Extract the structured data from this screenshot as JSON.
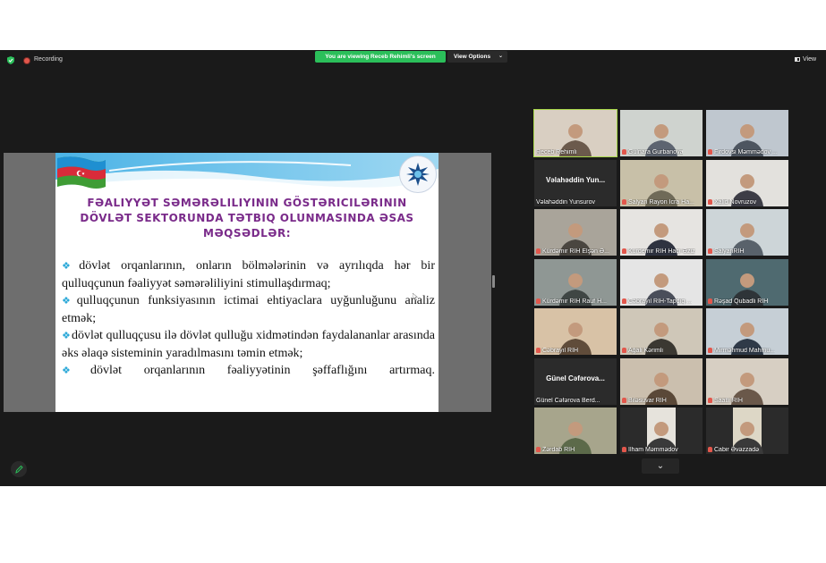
{
  "topbar": {
    "recording_label": "Recording",
    "banner_text": "You are viewing Receb Rehimli's screen",
    "view_options_label": "View Options",
    "view_label": "View"
  },
  "slide": {
    "title_lines": [
      "FƏALIYYƏT SƏMƏRƏLILIYININ GÖSTƏRICILƏRININ",
      "DÖVLƏT SEKTORUNDA TƏTBIQ OLUNMASINDA ƏSAS",
      "MƏQSƏDLƏR:"
    ],
    "bullets": [
      "dövlət orqanlarının, onların bölmələrinin və ayrılıqda hər bir qulluqçunun fəaliyyət səmərəliliyini stimullaşdırmaq;",
      "qulluqçunun funksiyasının ictimai ehtiyaclara uyğunluğunu analiz etmək;",
      "dövlət qulluqçusu ilə dövlət qulluğu xidmətindən faydalananlar arasında əks əlaqə sisteminin yaradılmasını təmin etmək;",
      "dövlət orqanlarının fəaliyyətinin şəffaflığını artırmaq."
    ]
  },
  "participants": [
    {
      "label": "Receb Rehimli",
      "muted": false,
      "active": true,
      "card": ""
    },
    {
      "label": "Gulnara Gurbanova",
      "muted": true,
      "active": false,
      "card": ""
    },
    {
      "label": "Firdovsi Məmmədov ...",
      "muted": true,
      "active": false,
      "card": ""
    },
    {
      "label": "Vəlahəddin Yunsurov",
      "muted": false,
      "active": false,
      "card": "Vəlahəddin Yun..."
    },
    {
      "label": "Salyan Rayon İcra Ha...",
      "muted": true,
      "active": false,
      "card": ""
    },
    {
      "label": "Xalid Novruzov",
      "muted": true,
      "active": false,
      "card": ""
    },
    {
      "label": "Kürdəmir RİH Elşən Ə...",
      "muted": true,
      "active": false,
      "card": ""
    },
    {
      "label": "Kurdemir RİH Hacı Əziz",
      "muted": true,
      "active": false,
      "card": ""
    },
    {
      "label": "SalyanRİH",
      "muted": true,
      "active": false,
      "card": ""
    },
    {
      "label": "Kürdəmir RİH Rauf H...",
      "muted": true,
      "active": false,
      "card": ""
    },
    {
      "label": "Cəbrayıl RİH-Tapdıq ...",
      "muted": true,
      "active": false,
      "card": ""
    },
    {
      "label": "Rəşad Qubadli RİH",
      "muted": true,
      "active": false,
      "card": ""
    },
    {
      "label": "Cəbrayıl RİH",
      "muted": true,
      "active": false,
      "card": ""
    },
    {
      "label": "Ağali Kərimli",
      "muted": true,
      "active": false,
      "card": ""
    },
    {
      "label": "Mirməhmud Mahmu...",
      "muted": true,
      "active": false,
      "card": ""
    },
    {
      "label": "Günel Cəfərova Berd...",
      "muted": false,
      "active": false,
      "card": "Günel Cəfərova..."
    },
    {
      "label": "Biləsuvar RİH",
      "muted": true,
      "active": false,
      "card": ""
    },
    {
      "label": "Saatlı RİH",
      "muted": true,
      "active": false,
      "card": ""
    },
    {
      "label": "Zərdab RİH",
      "muted": true,
      "active": false,
      "card": ""
    },
    {
      "label": "İlham Məmmədov",
      "muted": true,
      "active": false,
      "card": ""
    },
    {
      "label": "Cabir Əvəzzadə",
      "muted": true,
      "active": false,
      "card": ""
    }
  ],
  "icons": {
    "shield": "shield-icon",
    "recording": "recording-dot-icon",
    "view": "grid-view-icon",
    "chevron": "chevron-down-icon",
    "annotate": "pencil-icon"
  },
  "colors": {
    "banner_green": "#2bbf5a",
    "active_speaker": "#a8d84a",
    "title_purple": "#7a2b8a",
    "bullet_blue": "#2aa8d8",
    "muted_red": "#e2574c"
  }
}
